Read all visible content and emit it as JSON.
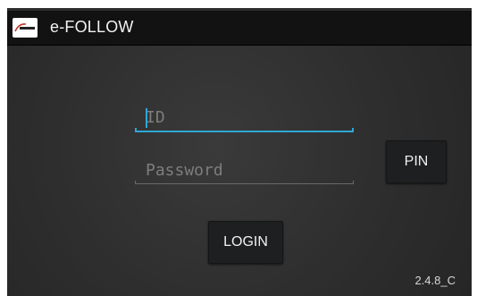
{
  "app": {
    "title": "e-FOLLOW",
    "logo_text": "e-FOLLOW"
  },
  "login_form": {
    "id_placeholder": "ID",
    "id_value": "",
    "password_placeholder": "Password",
    "password_value": "",
    "pin_button_label": "PIN",
    "login_button_label": "LOGIN"
  },
  "footer": {
    "version": "2.4.8_C"
  },
  "colors": {
    "accent": "#2fa7d6",
    "background": "#2e2e2e",
    "actionbar": "#121212",
    "button": "#1d1f20"
  }
}
